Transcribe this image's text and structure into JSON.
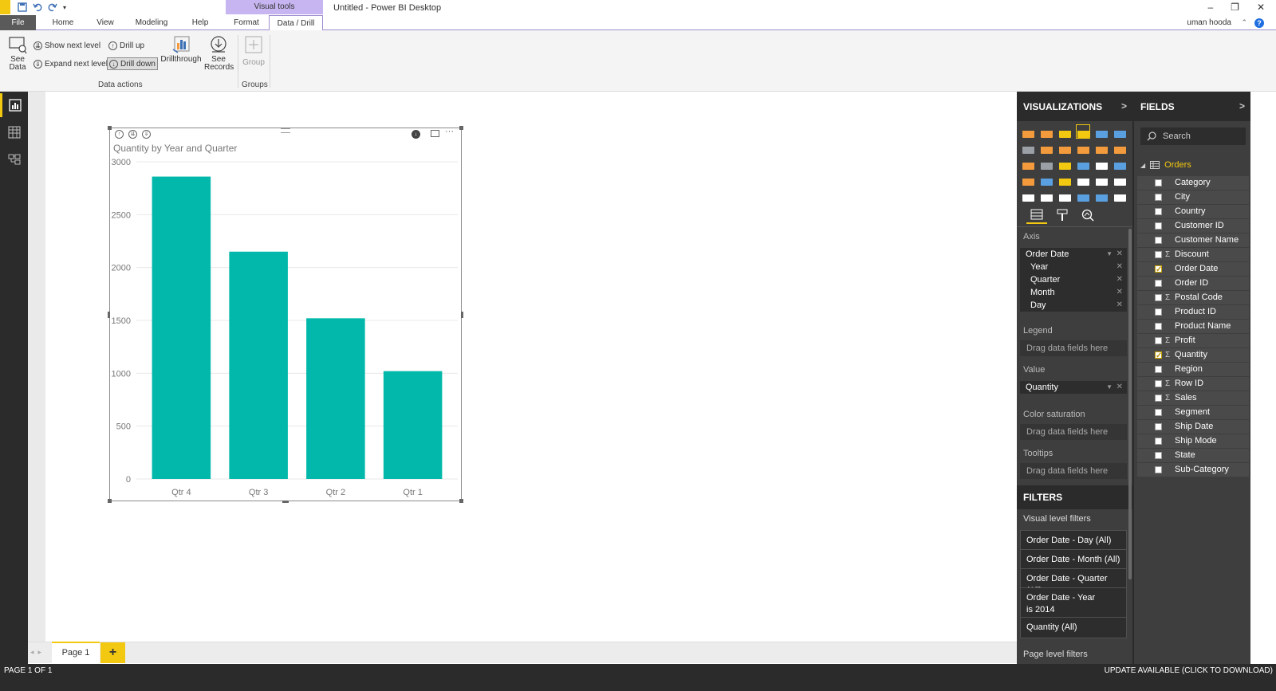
{
  "window": {
    "title": "Untitled - Power BI Desktop",
    "contextual_header": "Visual tools",
    "user": "uman hooda",
    "controls": [
      "–",
      "❐",
      "✕"
    ]
  },
  "tabs": [
    "File",
    "Home",
    "View",
    "Modeling",
    "Help",
    "Format",
    "Data / Drill"
  ],
  "ribbon": {
    "see_data": "See\nData",
    "show_next_level": "Show next level",
    "expand_next_level": "Expand next level",
    "drill_up": "Drill up",
    "drill_down": "Drill down",
    "drillthrough": "Drillthrough",
    "see_records": "See\nRecords",
    "group": "Group",
    "group_data_actions": "Data actions",
    "group_groups": "Groups"
  },
  "visual": {
    "title": "Quantity by Year and Quarter",
    "bar_color": "#01b8aa"
  },
  "chart_data": {
    "type": "bar",
    "title": "Quantity by Year and Quarter",
    "categories": [
      "Qtr 4",
      "Qtr 3",
      "Qtr 2",
      "Qtr 1"
    ],
    "values": [
      2860,
      2150,
      1520,
      1020
    ],
    "yticks": [
      0,
      500,
      1000,
      1500,
      2000,
      2500,
      3000
    ],
    "ylim": [
      0,
      3000
    ],
    "xlabel": "",
    "ylabel": "",
    "grid": true
  },
  "pages": {
    "current": "Page 1",
    "add": "+",
    "status": "PAGE 1 OF 1",
    "update_notice": "UPDATE AVAILABLE (CLICK TO DOWNLOAD)"
  },
  "visualizations": {
    "header": "VISUALIZATIONS",
    "icon_colors": [
      "#f39b3c",
      "#f39b3c",
      "#f2c811",
      "#f2c811",
      "#5aa0e0",
      "#5aa0e0",
      "#9aa0a6",
      "#f39b3c",
      "#f39b3c",
      "#f39b3c",
      "#f39b3c",
      "#f39b3c",
      "#f39b3c",
      "#9aa0a6",
      "#f2c811",
      "#5aa0e0",
      "#ffffff",
      "#5aa0e0",
      "#f39b3c",
      "#5aa0e0",
      "#f2c811",
      "#ffffff",
      "#ffffff",
      "#ffffff",
      "#ffffff",
      "#ffffff",
      "#ffffff",
      "#5aa0e0",
      "#5aa0e0",
      "#ffffff"
    ],
    "axis_label": "Axis",
    "axis_field": "Order Date",
    "axis_levels": [
      "Year",
      "Quarter",
      "Month",
      "Day"
    ],
    "legend_label": "Legend",
    "value_label": "Value",
    "value_field": "Quantity",
    "color_saturation_label": "Color saturation",
    "tooltips_label": "Tooltips",
    "drag_hint": "Drag data fields here"
  },
  "filters": {
    "header": "FILTERS",
    "visual_level": "Visual level filters",
    "items": [
      "Order Date - Day (All)",
      "Order Date - Month  (All)",
      "Order Date - Quarter  (All)",
      "Order Date - Year\nis 2014",
      "Quantity  (All)"
    ],
    "page_level": "Page level filters"
  },
  "fields": {
    "header": "FIELDS",
    "search_placeholder": "Search",
    "table": "Orders",
    "items": [
      {
        "name": "Category",
        "checked": false,
        "sigma": false
      },
      {
        "name": "City",
        "checked": false,
        "sigma": false
      },
      {
        "name": "Country",
        "checked": false,
        "sigma": false
      },
      {
        "name": "Customer ID",
        "checked": false,
        "sigma": false
      },
      {
        "name": "Customer Name",
        "checked": false,
        "sigma": false
      },
      {
        "name": "Discount",
        "checked": false,
        "sigma": true
      },
      {
        "name": "Order Date",
        "checked": true,
        "sigma": false
      },
      {
        "name": "Order ID",
        "checked": false,
        "sigma": false
      },
      {
        "name": "Postal Code",
        "checked": false,
        "sigma": true
      },
      {
        "name": "Product ID",
        "checked": false,
        "sigma": false
      },
      {
        "name": "Product Name",
        "checked": false,
        "sigma": false
      },
      {
        "name": "Profit",
        "checked": false,
        "sigma": true
      },
      {
        "name": "Quantity",
        "checked": true,
        "sigma": true
      },
      {
        "name": "Region",
        "checked": false,
        "sigma": false
      },
      {
        "name": "Row ID",
        "checked": false,
        "sigma": true
      },
      {
        "name": "Sales",
        "checked": false,
        "sigma": true
      },
      {
        "name": "Segment",
        "checked": false,
        "sigma": false
      },
      {
        "name": "Ship Date",
        "checked": false,
        "sigma": false
      },
      {
        "name": "Ship Mode",
        "checked": false,
        "sigma": false
      },
      {
        "name": "State",
        "checked": false,
        "sigma": false
      },
      {
        "name": "Sub-Category",
        "checked": false,
        "sigma": false
      }
    ]
  }
}
